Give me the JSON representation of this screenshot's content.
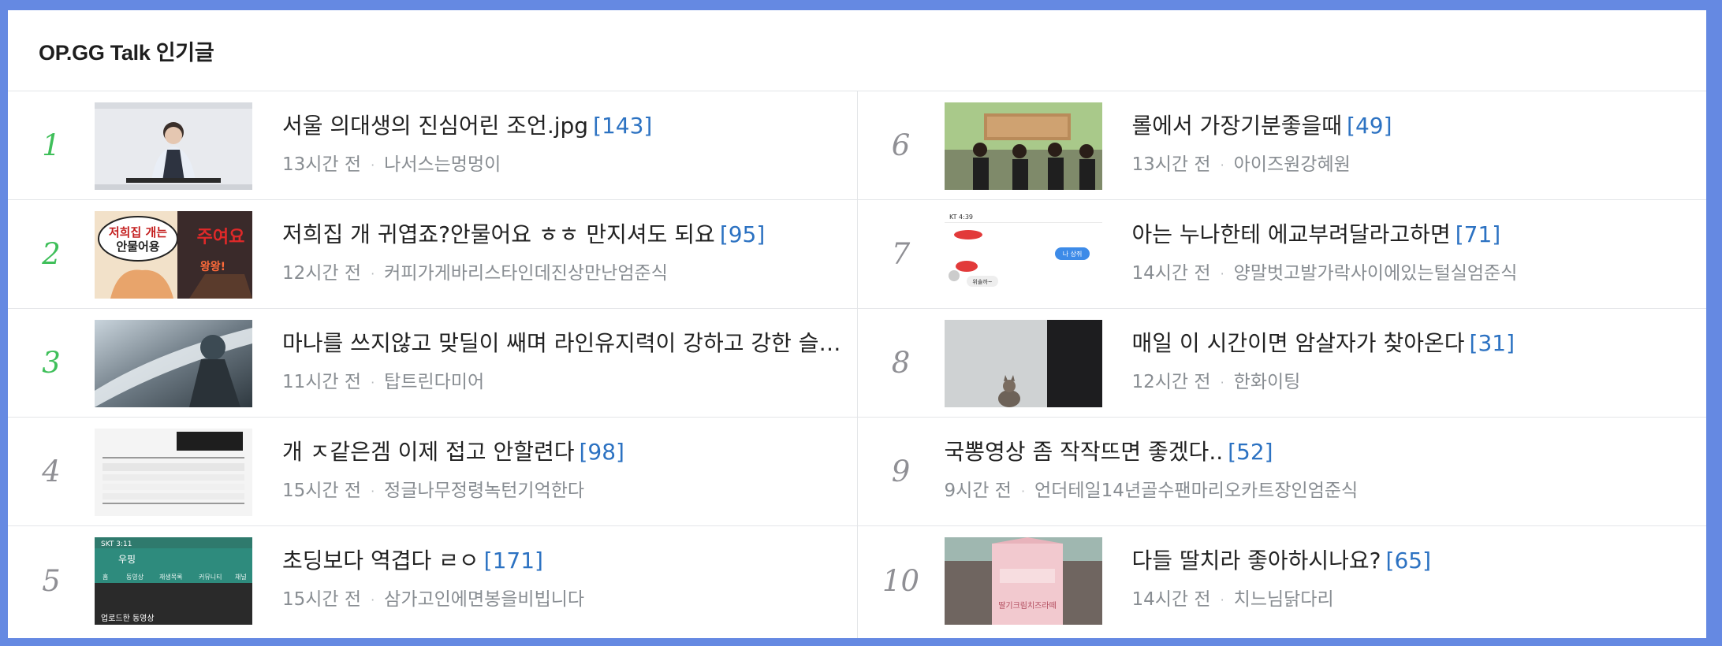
{
  "header": {
    "title": "OP.GG Talk 인기글"
  },
  "left_items": [
    {
      "rank": "1",
      "title": "서울 의대생의 진심어린 조언.jpg",
      "comments": "[143]",
      "time": "13시간 전",
      "author": "나서스는멍멍이"
    },
    {
      "rank": "2",
      "title": "저희집 개 귀엽죠?안물어요 ㅎㅎ 만지셔도 되요",
      "comments": "[95]",
      "time": "12시간 전",
      "author": "커피가게바리스타인데진상만난엄준식"
    },
    {
      "rank": "3",
      "title": "마나를 쓰지않고 맞딜이 쌔며 라인유지력이 강하고 강한 슬로우와 이속증가로 도주까지 가능한",
      "comments": "",
      "time": "11시간 전",
      "author": "탑트린다미어"
    },
    {
      "rank": "4",
      "title": "개 ㅈ같은겜 이제 접고 안할련다",
      "comments": "[98]",
      "time": "15시간 전",
      "author": "정글나무정령녹턴기억한다"
    },
    {
      "rank": "5",
      "title": "초딩보다 역겹다 ㄹㅇ",
      "comments": "[171]",
      "time": "15시간 전",
      "author": "삼가고인에면봉을비빕니다"
    }
  ],
  "right_items": [
    {
      "rank": "6",
      "title": "롤에서 가장기분좋을때",
      "comments": "[49]",
      "time": "13시간 전",
      "author": "아이즈원강혜원"
    },
    {
      "rank": "7",
      "title": "아는 누나한테 에교부려달라고하면",
      "comments": "[71]",
      "time": "14시간 전",
      "author": "양말벗고발가락사이에있는털실엄준식"
    },
    {
      "rank": "8",
      "title": "매일 이 시간이면 암살자가 찾아온다",
      "comments": "[31]",
      "time": "12시간 전",
      "author": "한화이팅"
    },
    {
      "rank": "9",
      "title": "국뽕영상 좀 작작뜨면 좋겠다..",
      "comments": "[52]",
      "time": "9시간 전",
      "author": "언더테일14년골수팬마리오카트장인엄준식"
    },
    {
      "rank": "10",
      "title": "다들 딸치라 좋아하시나요?",
      "comments": "[65]",
      "time": "14시간 전",
      "author": "치느님닭다리"
    }
  ],
  "thumb_text": {
    "t2_a": "저희집 개는",
    "t2_b": "안물어용",
    "t2_c": "주여요",
    "t2_d": "왕왕!",
    "t5_status": "SKT 3:11",
    "t5_title": "우핑",
    "t5_tab1": "홈",
    "t5_tab2": "동영상",
    "t5_tab3": "재생목록",
    "t5_tab4": "커뮤니티",
    "t5_tab5": "채널",
    "t5_bottom": "업로드한 동영상",
    "t7_status": "KT 4:39",
    "t7_bubble": "나 상쥐",
    "t7_line": "위솔까~",
    "t10_label": "딸기크림치즈라떼"
  },
  "colors": {
    "accent_rank": "#3fbf5a",
    "comment_count": "#2c72c2",
    "frame": "#6589e2"
  }
}
